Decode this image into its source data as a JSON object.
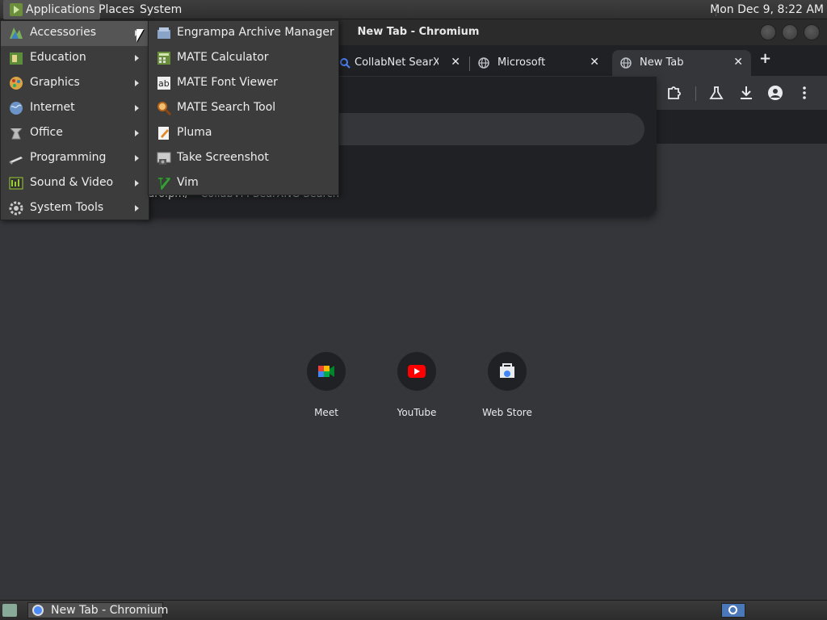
{
  "top_panel": {
    "applications_label": "Applications",
    "places_label": "Places",
    "system_label": "System",
    "clock": "Mon Dec  9,  8:22 AM"
  },
  "window": {
    "title": "New Tab - Chromium"
  },
  "tabs": [
    {
      "title": "CollabNet SearXN",
      "favicon": "search-icon",
      "active": false
    },
    {
      "title": "Microsoft",
      "favicon": "globe-icon",
      "active": false
    },
    {
      "title": "New Tab",
      "favicon": "globe-icon",
      "active": true
    }
  ],
  "new_tab_symbol": "+",
  "omnibox_suggestion": {
    "url": "dro.pm/",
    "separator": " – ",
    "title": "CollabVM SearXNG Search"
  },
  "shortcuts": [
    {
      "label": "Meet",
      "icon": "meet-icon"
    },
    {
      "label": "YouTube",
      "icon": "youtube-icon"
    },
    {
      "label": "Web Store",
      "icon": "web-store-icon"
    }
  ],
  "app_menu": {
    "items": [
      {
        "label": "Accessories",
        "icon": "accessories-icon",
        "selected": true
      },
      {
        "label": "Education",
        "icon": "education-icon"
      },
      {
        "label": "Graphics",
        "icon": "graphics-icon"
      },
      {
        "label": "Internet",
        "icon": "internet-icon"
      },
      {
        "label": "Office",
        "icon": "office-icon"
      },
      {
        "label": "Programming",
        "icon": "programming-icon"
      },
      {
        "label": "Sound & Video",
        "icon": "sound-video-icon"
      },
      {
        "label": "System Tools",
        "icon": "system-tools-icon"
      }
    ]
  },
  "accessories_submenu": {
    "items": [
      {
        "label": "Engrampa Archive Manager",
        "icon": "archive-icon"
      },
      {
        "label": "MATE Calculator",
        "icon": "calculator-icon"
      },
      {
        "label": "MATE Font Viewer",
        "icon": "font-viewer-icon"
      },
      {
        "label": "MATE Search Tool",
        "icon": "search-tool-icon"
      },
      {
        "label": "Pluma",
        "icon": "text-editor-icon"
      },
      {
        "label": "Take Screenshot",
        "icon": "screenshot-icon"
      },
      {
        "label": "Vim",
        "icon": "vim-icon"
      }
    ]
  },
  "bottom_panel": {
    "taskbar_label": "New Tab - Chromium"
  },
  "colors": {
    "panel_bg": "#303030",
    "menu_bg": "#3c3c3c",
    "menu_selected": "#555555",
    "chrome_dark": "#202124",
    "chrome_toolbar": "#35363a",
    "youtube_red": "#ff0000",
    "meet_green": "#00ac47"
  }
}
